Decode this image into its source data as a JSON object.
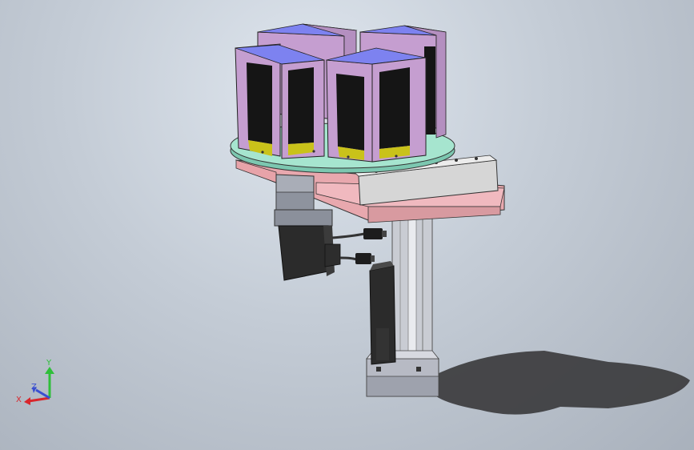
{
  "triad": {
    "y_label": "Y",
    "x_label": "X",
    "z_label": "Z",
    "y_color": "#2fbf3a",
    "x_color": "#d8262c",
    "z_color": "#3a4fd0"
  },
  "colors": {
    "cassette_side": "#c59ed0",
    "cassette_top": "#7d82f0",
    "cassette_front": "#151515",
    "turntable_top": "#a6e5cf",
    "base_plate_top": "#f0b9bf",
    "base_plate_side": "#d89aa0",
    "mount_bar": "#d6d6d6",
    "motor_body": "#2b2b2b",
    "bracket": "#bfc2cc",
    "shadow": "#3c3c3e"
  }
}
